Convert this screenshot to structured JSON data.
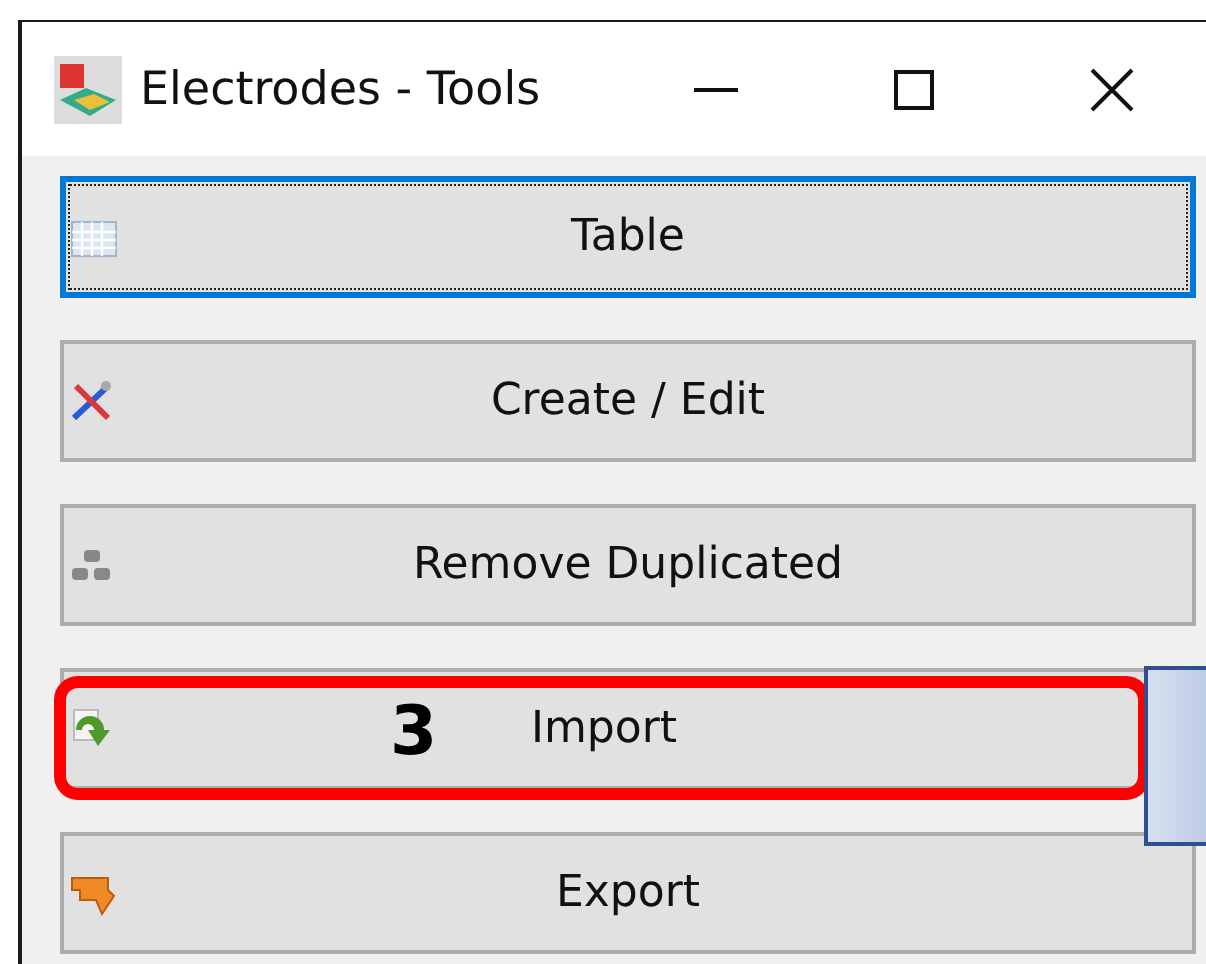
{
  "window": {
    "title": "Electrodes - Tools"
  },
  "buttons": [
    {
      "label": "Table",
      "focused": true
    },
    {
      "label": "Create / Edit",
      "focused": false
    },
    {
      "label": "Remove Duplicated",
      "focused": false
    },
    {
      "label": "Import",
      "focused": false
    },
    {
      "label": "Export",
      "focused": false
    }
  ],
  "annotation": {
    "label": "3"
  }
}
